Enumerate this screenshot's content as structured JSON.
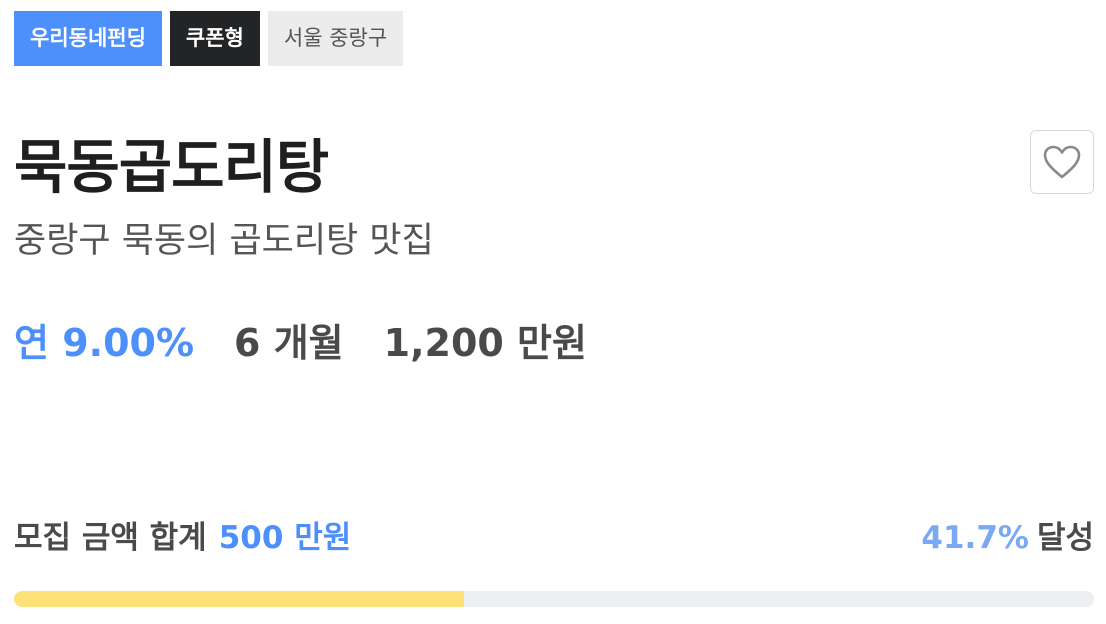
{
  "tags": [
    {
      "label": "우리동네펀딩",
      "color": "#4d8ffb"
    },
    {
      "label": "쿠폰형",
      "color": "#222426"
    },
    {
      "label": "서울 중랑구",
      "color": "#ececec"
    }
  ],
  "title": "묵동곱도리탕",
  "subtitle": "중랑구 묵동의 곱도리탕 맛집",
  "terms": {
    "rate": "연 9.00%",
    "period": "6 개월",
    "target": "1,200 만원"
  },
  "funding": {
    "label": "모집 금액 합계",
    "amount": "500 만원",
    "percent": "41.7%",
    "percent_suffix": "달성",
    "progress_fraction": 0.417
  },
  "icons": {
    "favorite": "heart-icon"
  },
  "colors": {
    "accent": "#4d8ffb",
    "progress": "#fde27a",
    "track": "#eceeef"
  }
}
